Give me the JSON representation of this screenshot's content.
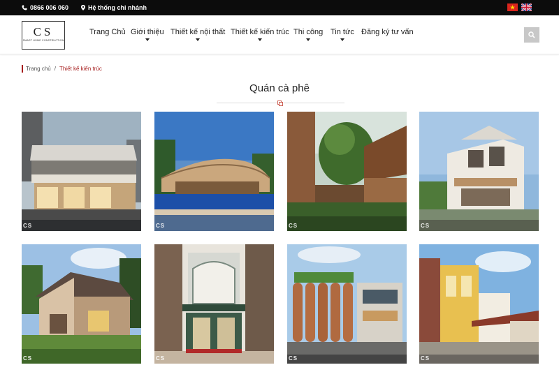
{
  "topbar": {
    "phone": "0866 006 060",
    "branch": "Hệ thống chi nhánh",
    "languages": [
      "vi-flag-icon",
      "en-flag-icon"
    ]
  },
  "logo": {
    "mark": "CS",
    "tagline": "SMART HOME CONSTRUCTION"
  },
  "nav": {
    "items": [
      {
        "label": "Trang Chủ",
        "has_dropdown": false
      },
      {
        "label": "Giới thiệu",
        "has_dropdown": true
      },
      {
        "label": "Thiết kế nội thất",
        "has_dropdown": true
      },
      {
        "label": "Thiết kế kiến trúc",
        "has_dropdown": true
      },
      {
        "label": "Thi công",
        "has_dropdown": true
      },
      {
        "label": "Tin tức",
        "has_dropdown": true
      },
      {
        "label": "Đăng ký tư vấn",
        "has_dropdown": false
      }
    ]
  },
  "breadcrumb": {
    "home": "Trang chủ",
    "separator": "/",
    "current": "Thiết kế kiến trúc"
  },
  "page": {
    "title": "Quán cà phê"
  },
  "gallery": {
    "watermark": "CS",
    "items": [
      {
        "name": "project-image-1",
        "scene": "modern-white-cafe"
      },
      {
        "name": "project-image-2",
        "scene": "pool-resort-cafe"
      },
      {
        "name": "project-image-3",
        "scene": "garden-pergola-cafe"
      },
      {
        "name": "project-image-4",
        "scene": "white-townhouse-cafe"
      },
      {
        "name": "project-image-5",
        "scene": "cottage-cafe"
      },
      {
        "name": "project-image-6",
        "scene": "classic-green-facade"
      },
      {
        "name": "project-image-7",
        "scene": "brick-cylinder-facade"
      },
      {
        "name": "project-image-8",
        "scene": "yellow-villa-cafe"
      }
    ]
  },
  "colors": {
    "topbar_bg": "#0c0c0c",
    "accent": "#a51c1c",
    "search_bg": "#c8c8c8"
  }
}
